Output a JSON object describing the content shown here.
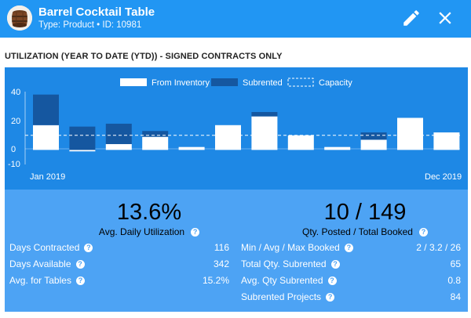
{
  "header": {
    "title": "Barrel Cocktail Table",
    "subtitle": "Type: Product • ID: 10981",
    "edit_icon": "pencil-icon",
    "close_icon": "close-icon",
    "avatar": "product-thumbnail"
  },
  "section_title": "UTILIZATION (YEAR TO DATE (YTD)) - SIGNED CONTRACTS ONLY",
  "colors": {
    "header": "#2196f3",
    "chart_bg": "#1e88e5",
    "stats_bg": "#4da3f4",
    "subrented": "#1557a0",
    "inventory": "#ffffff"
  },
  "chart_data": {
    "type": "bar",
    "stacked": true,
    "legend": [
      "From Inventory",
      "Subrented",
      "Capacity"
    ],
    "legend_position": "top",
    "y_ticks": [
      "40",
      "20",
      "0",
      "-10"
    ],
    "ylim": [
      -10,
      40
    ],
    "x_start_label": "Jan 2019",
    "x_end_label": "Dec 2019",
    "capacity": 10,
    "series": [
      {
        "name": "From Inventory",
        "values": [
          17,
          -1,
          4,
          9,
          2,
          17,
          23,
          10,
          2,
          7,
          22,
          12
        ]
      },
      {
        "name": "Subrented",
        "values": [
          21,
          16,
          14,
          4,
          0,
          0,
          3,
          0,
          0,
          5,
          0,
          0
        ]
      }
    ]
  },
  "stats": {
    "left": {
      "big_value": "13.6%",
      "caption": "Avg. Daily Utilization",
      "rows": [
        {
          "label": "Days Contracted",
          "value": "116"
        },
        {
          "label": "Days Available",
          "value": "342"
        },
        {
          "label": "Avg. for Tables",
          "value": "15.2%"
        }
      ]
    },
    "right": {
      "big_value": "10 / 149",
      "caption": "Qty. Posted / Total Booked",
      "rows": [
        {
          "label": "Min / Avg / Max Booked",
          "value": "2 / 3.2 / 26"
        },
        {
          "label": "Total Qty. Subrented",
          "value": "65"
        },
        {
          "label": "Avg. Qty Subrented",
          "value": "0.8"
        },
        {
          "label": "Subrented Projects",
          "value": "84"
        }
      ]
    }
  }
}
